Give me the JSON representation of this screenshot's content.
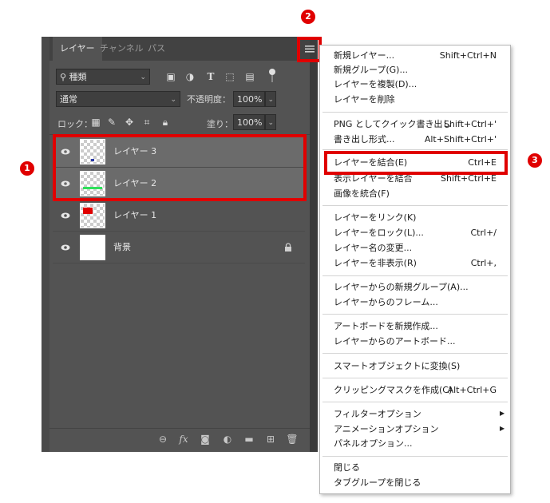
{
  "panel": {
    "tabs": [
      {
        "label": "レイヤー",
        "active": true
      },
      {
        "label": "チャンネル",
        "active": false
      },
      {
        "label": "パス",
        "active": false
      }
    ],
    "filter": {
      "label": "種類"
    },
    "blend_mode": "通常",
    "opacity_label": "不透明度：",
    "opacity_value": "100%",
    "lock_label": "ロック：",
    "fill_label": "塗り：",
    "fill_value": "100%",
    "layers": [
      {
        "name": "レイヤー 3",
        "selected": true
      },
      {
        "name": "レイヤー 2",
        "selected": true
      },
      {
        "name": "レイヤー 1",
        "selected": false
      },
      {
        "name": "背景",
        "selected": false,
        "locked": true
      }
    ],
    "bottom_icons": [
      "link-icon",
      "fx-icon",
      "mask-icon",
      "adjustment-icon",
      "folder-icon",
      "new-layer-icon",
      "trash-icon"
    ]
  },
  "menu": {
    "items": [
      {
        "label": "新規レイヤー...",
        "shortcut": "Shift+Ctrl+N"
      },
      {
        "label": "新規グループ(G)...",
        "shortcut": ""
      },
      {
        "label": "レイヤーを複製(D)...",
        "shortcut": ""
      },
      {
        "label": "レイヤーを削除",
        "shortcut": ""
      },
      {
        "label": "PNG としてクイック書き出し",
        "shortcut": "Shift+Ctrl+'"
      },
      {
        "label": "書き出し形式...",
        "shortcut": "Alt+Shift+Ctrl+'"
      },
      {
        "label": "レイヤーを結合(E)",
        "shortcut": "Ctrl+E"
      },
      {
        "label": "表示レイヤーを結合",
        "shortcut": "Shift+Ctrl+E"
      },
      {
        "label": "画像を統合(F)",
        "shortcut": ""
      },
      {
        "label": "レイヤーをリンク(K)",
        "shortcut": ""
      },
      {
        "label": "レイヤーをロック(L)...",
        "shortcut": "Ctrl+/"
      },
      {
        "label": "レイヤー名の変更...",
        "shortcut": ""
      },
      {
        "label": "レイヤーを非表示(R)",
        "shortcut": "Ctrl+,"
      },
      {
        "label": "レイヤーからの新規グループ(A)...",
        "shortcut": ""
      },
      {
        "label": "レイヤーからのフレーム...",
        "shortcut": ""
      },
      {
        "label": "アートボードを新規作成...",
        "shortcut": ""
      },
      {
        "label": "レイヤーからのアートボード...",
        "shortcut": ""
      },
      {
        "label": "スマートオブジェクトに変換(S)",
        "shortcut": ""
      },
      {
        "label": "クリッピングマスクを作成(C)",
        "shortcut": "Alt+Ctrl+G"
      },
      {
        "label": "フィルターオプション",
        "shortcut": ""
      },
      {
        "label": "アニメーションオプション",
        "shortcut": ""
      },
      {
        "label": "パネルオプション...",
        "shortcut": ""
      },
      {
        "label": "閉じる",
        "shortcut": ""
      },
      {
        "label": "タブグループを閉じる",
        "shortcut": ""
      }
    ]
  },
  "callouts": [
    "1",
    "2",
    "3"
  ],
  "colors": {
    "highlight_red": "#e00000",
    "panel_bg": "#535353",
    "selected_row": "#6b6b6b"
  }
}
